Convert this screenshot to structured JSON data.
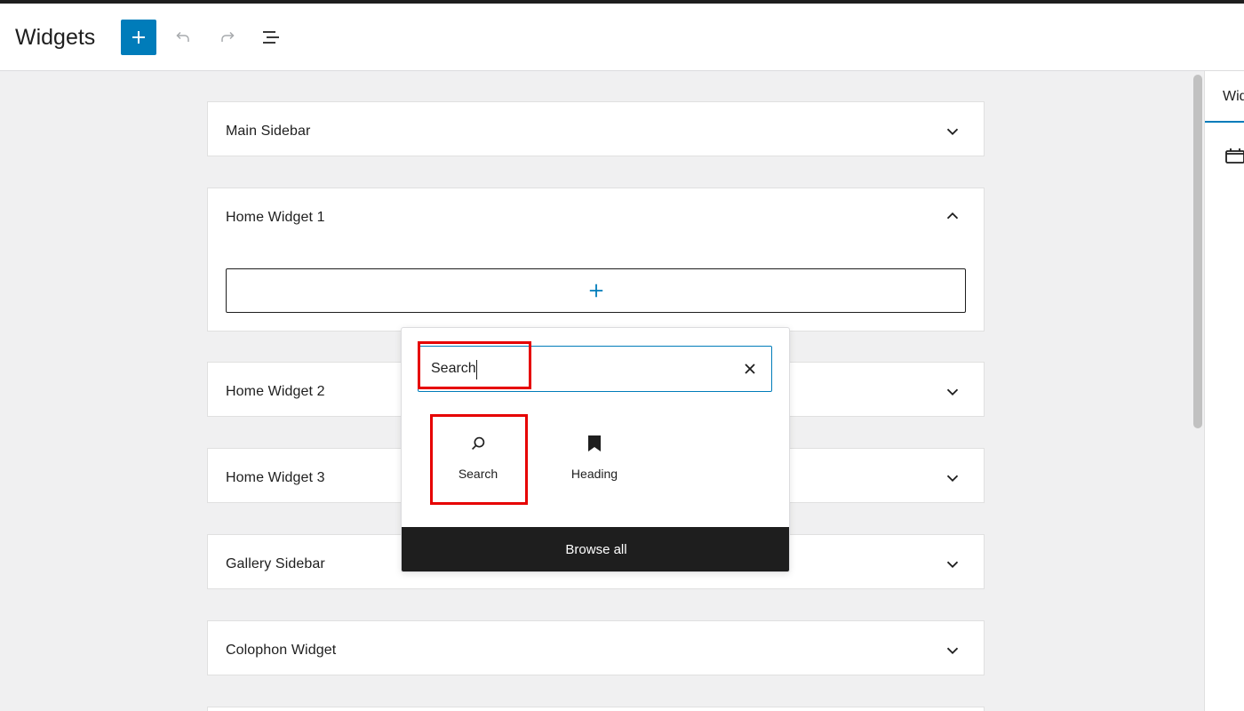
{
  "header": {
    "title": "Widgets"
  },
  "areas": [
    {
      "title": "Main Sidebar",
      "expanded": false
    },
    {
      "title": "Home Widget 1",
      "expanded": true
    },
    {
      "title": "Home Widget 2",
      "expanded": false
    },
    {
      "title": "Home Widget 3",
      "expanded": false
    },
    {
      "title": "Gallery Sidebar",
      "expanded": false
    },
    {
      "title": "Colophon Widget",
      "expanded": false
    }
  ],
  "inserter": {
    "search_value": "Search",
    "results": [
      {
        "label": "Search",
        "icon": "search-icon"
      },
      {
        "label": "Heading",
        "icon": "bookmark-icon"
      }
    ],
    "browse_all": "Browse all"
  },
  "sidebar": {
    "tab_label": "Widgets"
  },
  "colors": {
    "accent": "#007cba",
    "highlight": "#e60000",
    "dark": "#1e1e1e"
  }
}
